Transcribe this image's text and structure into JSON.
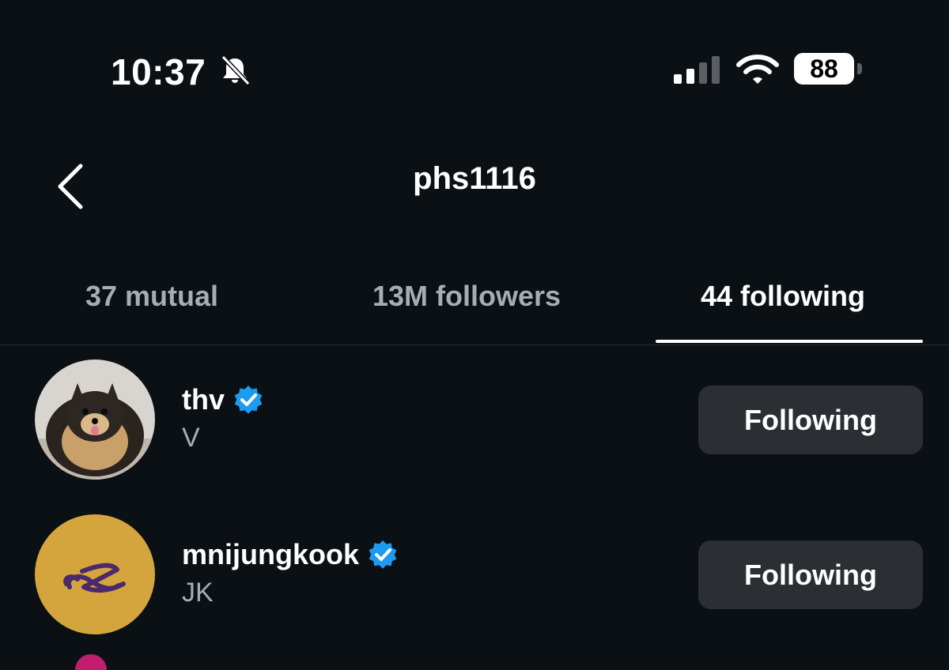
{
  "status_bar": {
    "time": "10:37",
    "battery_level": "88",
    "icons": [
      "silent-bell-icon",
      "cellular-signal-icon",
      "wifi-icon",
      "battery-icon"
    ]
  },
  "header": {
    "title": "phs1116",
    "back_icon": "chevron-left-icon"
  },
  "tabs": [
    {
      "label": "37 mutual",
      "active": false
    },
    {
      "label": "13M followers",
      "active": false
    },
    {
      "label": "44 following",
      "active": true
    }
  ],
  "list": [
    {
      "username": "thv",
      "name": "V",
      "verified": true,
      "button": "Following"
    },
    {
      "username": "mnijungkook",
      "name": "JK",
      "verified": true,
      "button": "Following"
    }
  ],
  "colors": {
    "background": "#0b1014",
    "button": "#2b2f34",
    "verified": "#1d9bf0",
    "muted_text": "#a8adb2"
  }
}
